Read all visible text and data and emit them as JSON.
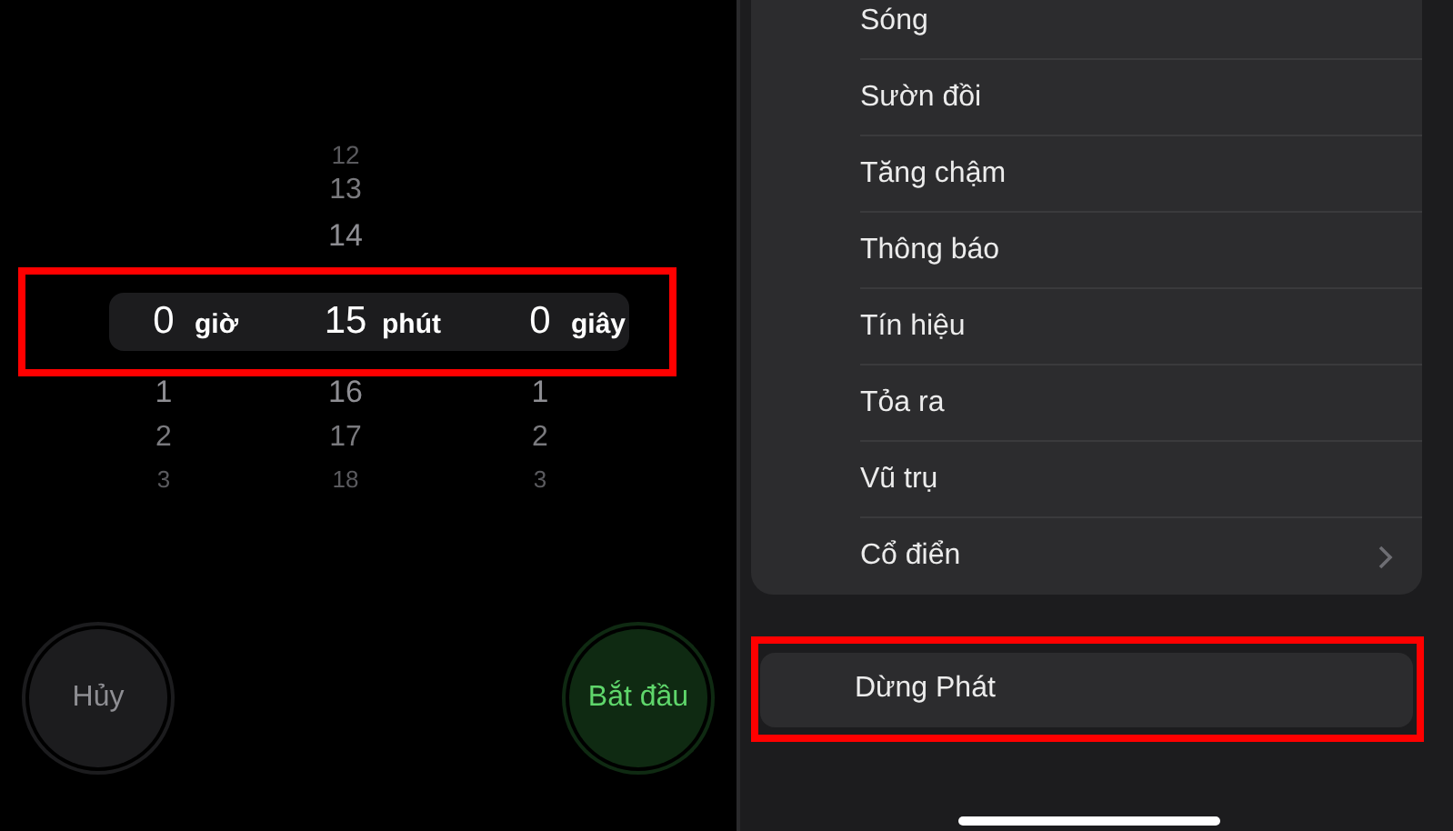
{
  "timer": {
    "picker": {
      "highlighted": true,
      "columns": [
        {
          "unit": "giờ",
          "value": "0",
          "below": [
            "1",
            "2",
            "3"
          ]
        },
        {
          "unit": "phút",
          "value": "15",
          "above": [
            "12",
            "13",
            "14"
          ],
          "below": [
            "16",
            "17",
            "18"
          ]
        },
        {
          "unit": "giây",
          "value": "0",
          "below": [
            "1",
            "2",
            "3"
          ]
        }
      ]
    },
    "buttons": [
      {
        "label": "Hủy",
        "kind": "cancel"
      },
      {
        "label": "Bắt đầu",
        "kind": "start"
      }
    ]
  },
  "sounds": {
    "items": [
      {
        "label": "Sóng",
        "kind": "plain"
      },
      {
        "label": "Sườn đồi",
        "kind": "plain"
      },
      {
        "label": "Tăng chậm",
        "kind": "plain"
      },
      {
        "label": "Thông báo",
        "kind": "plain"
      },
      {
        "label": "Tín hiệu",
        "kind": "plain"
      },
      {
        "label": "Tỏa ra",
        "kind": "plain"
      },
      {
        "label": "Vũ trụ",
        "kind": "plain"
      },
      {
        "label": "Cổ điển",
        "kind": "submenu"
      }
    ],
    "stop_option": {
      "label": "Dừng Phát",
      "highlighted": true
    }
  }
}
